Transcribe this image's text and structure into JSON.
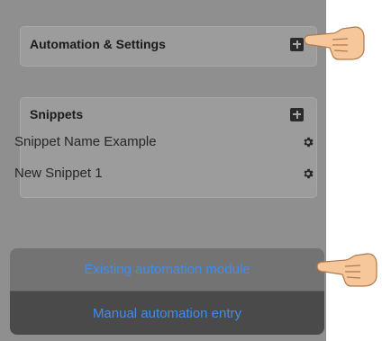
{
  "automation_card": {
    "title": "Automation & Settings",
    "add_icon": "plus-square-icon"
  },
  "snippets_card": {
    "title": "Snippets",
    "add_icon": "plus-square-icon",
    "items": [
      {
        "name": "Snippet Name Example",
        "icon": "gear-icon"
      },
      {
        "name": "New Snippet 1",
        "icon": "gear-icon"
      }
    ]
  },
  "action_sheet": {
    "options": [
      {
        "label": "Existing automation module"
      },
      {
        "label": "Manual automation entry"
      }
    ]
  },
  "annotations": {
    "pointer_icon": "pointing-hand-icon"
  },
  "colors": {
    "option_text": "#3d8ef0",
    "screen_bg": "#8f8f8f"
  }
}
